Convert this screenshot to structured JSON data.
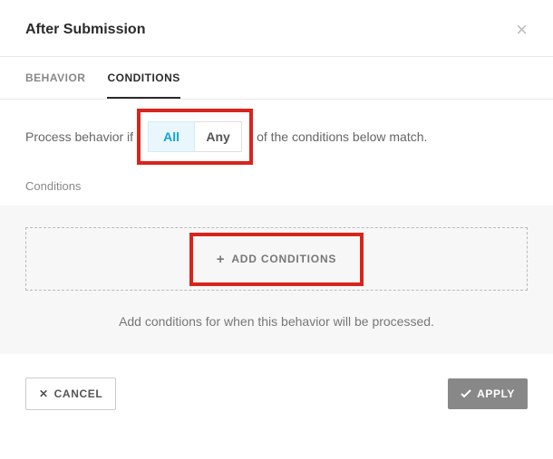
{
  "header": {
    "title": "After Submission"
  },
  "tabs": {
    "behavior": "BEHAVIOR",
    "conditions": "CONDITIONS",
    "active": "conditions"
  },
  "process": {
    "prefix": "Process behavior if",
    "all": "All",
    "any": "Any",
    "suffix": "of the conditions below match.",
    "selected": "all"
  },
  "conditions": {
    "label": "Conditions",
    "add_label": "ADD CONDITIONS",
    "hint": "Add conditions for when this behavior will be processed."
  },
  "footer": {
    "cancel": "CANCEL",
    "apply": "APPLY"
  }
}
